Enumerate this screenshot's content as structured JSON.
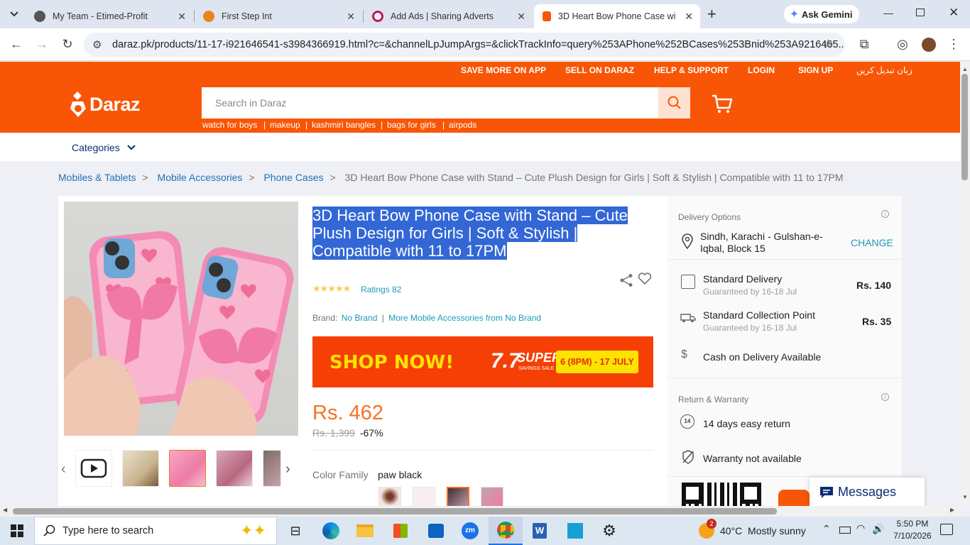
{
  "browser": {
    "tabs": [
      {
        "title": "My Team - Etimed-Profit",
        "icon": "team-icon"
      },
      {
        "title": "First Step Int",
        "icon": "firststep-icon"
      },
      {
        "title": "Add Ads | Sharing Adverts",
        "icon": "adverts-icon"
      },
      {
        "title": "3D Heart Bow Phone Case with",
        "icon": "daraz-favicon"
      }
    ],
    "new_tab": "+",
    "gemini": "Ask Gemini",
    "url": "daraz.pk/products/11-17-i921646541-s3984366919.html?c=&channelLpJumpArgs=&clickTrackInfo=query%253APhone%252BCases%253Bnid%253A9216465..."
  },
  "header": {
    "top_links": [
      "SAVE MORE ON APP",
      "SELL ON DARAZ",
      "HELP & SUPPORT",
      "LOGIN",
      "SIGN UP",
      "زبان تبدیل کریں"
    ],
    "logo": "Daraz",
    "search_placeholder": "Search in Daraz",
    "keywords": [
      "watch for boys",
      "makeup",
      "kashmiri bangles",
      "bags for girls",
      "airpods"
    ],
    "categories": "Categories"
  },
  "breadcrumb": [
    "Mobiles & Tablets",
    "Mobile Accessories",
    "Phone Cases",
    "3D Heart Bow Phone Case with Stand – Cute Plush Design for Girls | Soft & Stylish | Compatible with 11 to 17PM"
  ],
  "product": {
    "title": "3D Heart Bow Phone Case with Stand – Cute Plush Design for Girls | Soft & Stylish | Compatible with 11 to 17PM",
    "rating_stars": 5,
    "ratings_text": "Ratings 82",
    "brand_label": "Brand:",
    "brand": "No Brand",
    "more_from": "More Mobile Accessories from No Brand",
    "banner": {
      "left": "SHOP NOW!",
      "mid": "7.7",
      "mid2": "SUPER",
      "mid3": "SAVINGS SALE",
      "right": "6 (8PM) - 17 JULY"
    },
    "price": "Rs. 462",
    "old_price": "Rs. 1,399",
    "discount": "-67%",
    "color_label": "Color Family",
    "color_value": "paw black"
  },
  "delivery": {
    "title": "Delivery Options",
    "location": "Sindh, Karachi - Gulshan-e-Iqbal, Block 15",
    "change": "CHANGE",
    "standard": {
      "name": "Standard Delivery",
      "sub": "Guaranteed by 16-18 Jul",
      "price": "Rs. 140"
    },
    "collection": {
      "name": "Standard Collection Point",
      "sub": "Guaranteed by 16-18 Jul",
      "price": "Rs. 35"
    },
    "cod": "Cash on Delivery Available",
    "return_title": "Return & Warranty",
    "return": "14 days easy return",
    "warranty": "Warranty not available",
    "messages": "Messages"
  },
  "taskbar": {
    "search_placeholder": "Type here to search",
    "weather": "40°C  Mostly sunny",
    "time": "5:50 PM",
    "date": "7/10/2026",
    "outlook_badge": "2"
  }
}
